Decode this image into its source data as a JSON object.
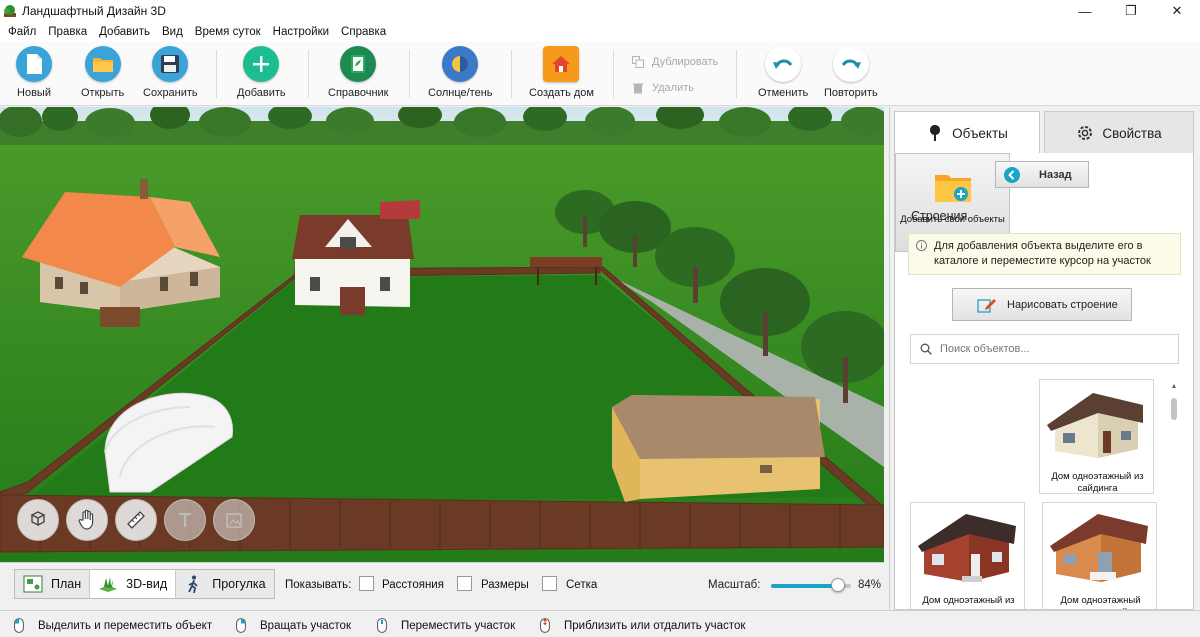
{
  "window": {
    "title": "Ландшафтный Дизайн 3D",
    "controls": [
      "—",
      "❐",
      "✕"
    ]
  },
  "menu": [
    "Файл",
    "Правка",
    "Добавить",
    "Вид",
    "Время суток",
    "Настройки",
    "Справка"
  ],
  "toolbar": {
    "new": "Новый",
    "open": "Открыть",
    "save": "Сохранить",
    "add": "Добавить",
    "reference": "Справочник",
    "sun_shadow": "Солнце/тень",
    "create_house": "Создать дом",
    "duplicate": "Дублировать",
    "delete": "Удалить",
    "undo": "Отменить",
    "redo": "Повторить"
  },
  "colors": {
    "accent": "#1aa4c8",
    "grass": "#23771a",
    "fence": "#5a2e1c",
    "orange_roof": "#f2884a",
    "brown_roof": "#7a3a2c"
  },
  "view_modes": {
    "plan": "План",
    "view3d": "3D-вид",
    "walk": "Прогулка",
    "active": "3D-вид"
  },
  "show": {
    "label": "Показывать:",
    "distances": {
      "label": "Расстояния",
      "checked": false
    },
    "sizes": {
      "label": "Размеры",
      "checked": false
    },
    "grid": {
      "label": "Сетка",
      "checked": false
    }
  },
  "zoom": {
    "label": "Масштаб:",
    "value_text": "84%",
    "fraction": 0.84
  },
  "status": {
    "select_move": "Выделить и переместить объект",
    "rotate": "Вращать участок",
    "move_plot": "Переместить участок",
    "zoom": "Приблизить или отдалить участок"
  },
  "panel": {
    "tabs": {
      "objects": "Объекты",
      "properties": "Свойства"
    },
    "back": "Назад",
    "section_title": "Строения",
    "info": "Для добавления объекта выделите его в каталоге и переместите курсор на участок",
    "draw_button": "Нарисовать строение",
    "search_placeholder": "Поиск объектов...",
    "add_own": "Добавить свои объекты",
    "items": [
      {
        "label": "Дом одноэтажный из сайдинга",
        "icon": "siding-house-icon"
      },
      {
        "label": "Дом одноэтажный из кирпича",
        "icon": "brick-house-icon"
      },
      {
        "label": "Дом одноэтажный деревянный",
        "icon": "wooden-house-icon"
      }
    ]
  }
}
